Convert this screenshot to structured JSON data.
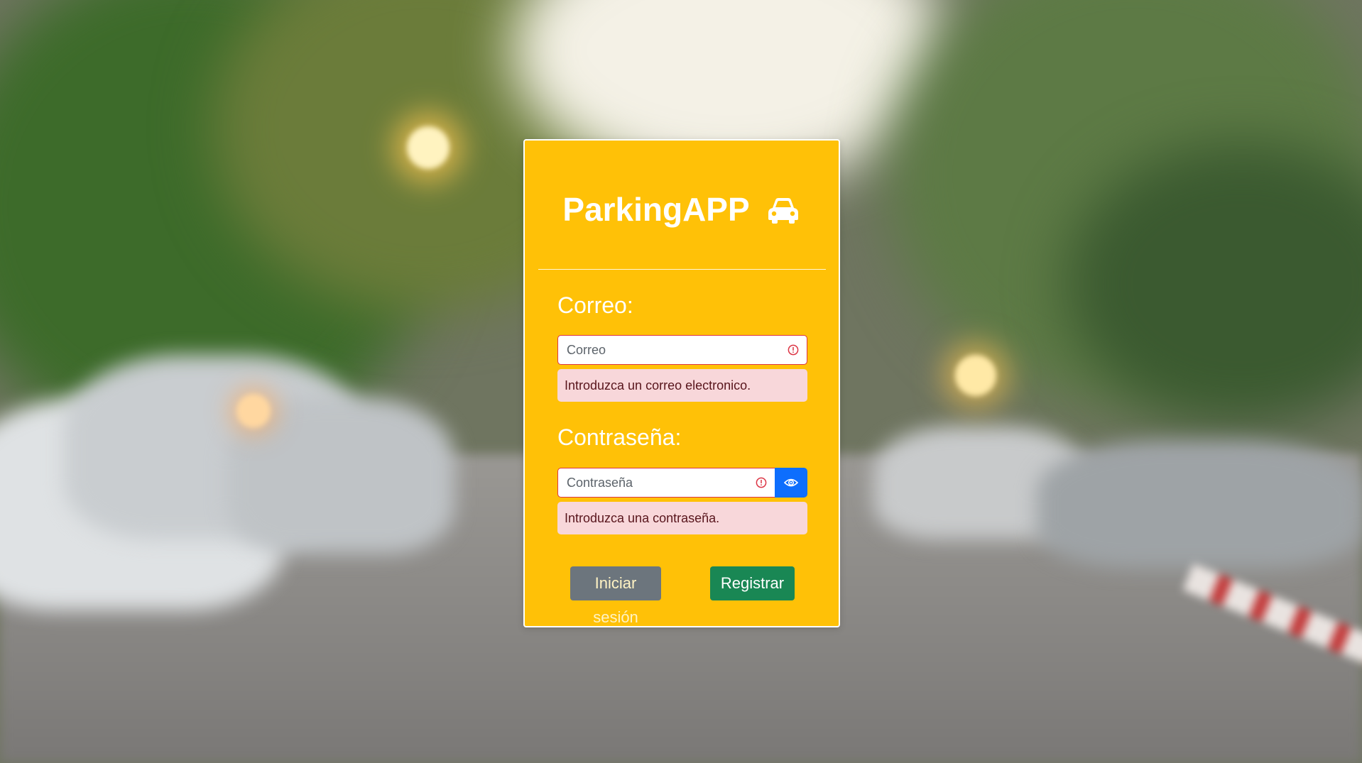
{
  "app": {
    "title": "ParkingAPP",
    "title_icon": "car-icon"
  },
  "form": {
    "email": {
      "label": "Correo:",
      "placeholder": "Correo",
      "value": "",
      "error": "Introduzca un correo electronico.",
      "error_icon": "exclamation-circle-icon"
    },
    "password": {
      "label": "Contraseña:",
      "placeholder": "Contraseña",
      "value": "",
      "error": "Introduzca una contraseña.",
      "error_icon": "exclamation-circle-icon",
      "toggle_icon": "eye-icon"
    },
    "buttons": {
      "login": "Iniciar sesión",
      "register": "Registrar"
    }
  },
  "colors": {
    "card": "#ffc107",
    "error_border": "#dc3545",
    "error_bg": "#f8d7da",
    "toggle": "#0d6efd",
    "login": "#6c757d",
    "register": "#198754"
  }
}
